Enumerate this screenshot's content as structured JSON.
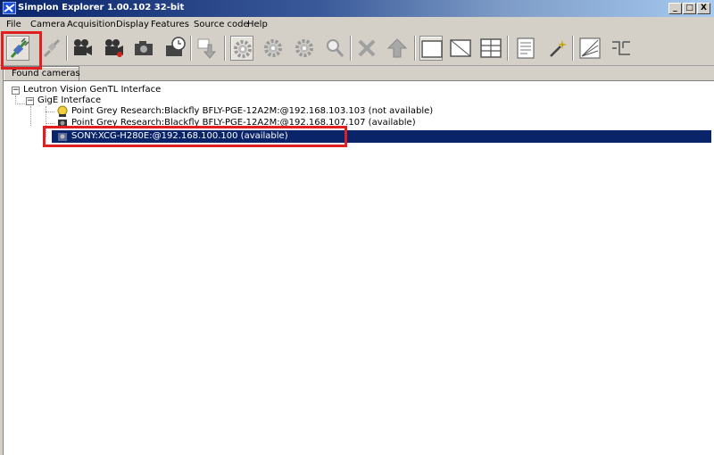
{
  "window": {
    "title": "Simplon Explorer 1.00.102 32-bit",
    "minimize_label": "_",
    "maximize_label": "□",
    "close_label": "X"
  },
  "menu": [
    "File",
    "Camera",
    "Acquisition",
    "Display",
    "Features",
    "Source code",
    "Help"
  ],
  "toolbar": {
    "buttons": [
      "connect-icon",
      "disconnect-icon",
      "video-camera-icon",
      "video-camera-red-icon",
      "snapshot-camera-icon",
      "timed-camera-icon",
      "download-icon",
      "settings-gear-icon",
      "gear-icon",
      "gear-alt-icon",
      "magnifier-icon",
      "tools-icon",
      "up-arrow-icon",
      "single-view-icon",
      "split-view-icon",
      "grid-view-icon",
      "document-icon",
      "magic-wand-icon",
      "chart-icon",
      "route-icon"
    ]
  },
  "tabs": [
    {
      "label": "Found cameras"
    }
  ],
  "tree": {
    "root": "Leutron Vision GenTL Interface",
    "interface": "GigE Interface",
    "cameras": [
      {
        "label": "Point Grey Research:Blackfly BFLY-PGE-12A2M:@192.168.103.103 (not available)",
        "status": "not available"
      },
      {
        "label": "Point Grey Research:Blackfly BFLY-PGE-12A2M:@192.168.107.107 (available)",
        "status": "available"
      },
      {
        "label": "SONY:XCG-H280E:@192.168.100.100 (available)",
        "status": "available",
        "selected": true
      }
    ]
  },
  "annotations": {
    "highlight_color": "#e02020"
  }
}
